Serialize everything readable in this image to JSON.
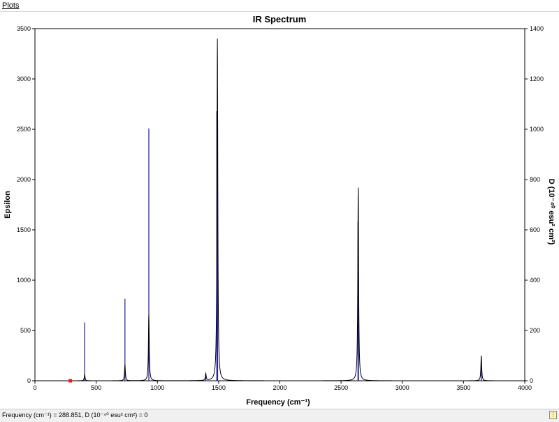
{
  "menu": {
    "plots_label": "Plots"
  },
  "status": {
    "text": "Frequency (cm⁻¹) = 288.851, D (10⁻⁴⁰ esu² cm²) = 0",
    "grip_icon": "resize-grip-icon"
  },
  "colors": {
    "spectrum_line": "#000000",
    "stick_bars": "#1a1aa0",
    "cursor_marker": "#dd2222"
  },
  "chart_data": {
    "type": "line",
    "title": "IR Spectrum",
    "xlabel": "Frequency (cm⁻¹)",
    "ylabel_left": "Epsilon",
    "ylabel_right": "D (10⁻⁴⁰ esu² cm²)",
    "xlim": [
      0,
      4000
    ],
    "ylim_left": [
      0,
      3500
    ],
    "ylim_right": [
      0,
      1400
    ],
    "x_ticks": [
      "0",
      "500",
      "1000",
      "1500",
      "2000",
      "2500",
      "3000",
      "3500",
      "4000"
    ],
    "y_left_ticks": [
      "0",
      "500",
      "1000",
      "1500",
      "2000",
      "2500",
      "3000",
      "3500"
    ],
    "y_right_ticks": [
      "0",
      "200",
      "400",
      "600",
      "800",
      "1000",
      "1200",
      "1400"
    ],
    "grid": false,
    "cursor_marker_x": 288.851,
    "series": [
      {
        "kind": "spectrum_epsilon",
        "peaks": [
          {
            "x": 406,
            "y": 60
          },
          {
            "x": 735,
            "y": 160
          },
          {
            "x": 930,
            "y": 650
          },
          {
            "x": 1395,
            "y": 70
          },
          {
            "x": 1490,
            "y": 3400
          },
          {
            "x": 2640,
            "y": 1920
          },
          {
            "x": 3645,
            "y": 250
          }
        ]
      },
      {
        "kind": "stick_D",
        "sticks": [
          {
            "x": 406,
            "y": 232
          },
          {
            "x": 735,
            "y": 326
          },
          {
            "x": 930,
            "y": 1003
          },
          {
            "x": 1395,
            "y": 20
          },
          {
            "x": 1485,
            "y": 1072
          },
          {
            "x": 1492,
            "y": 1040
          },
          {
            "x": 2638,
            "y": 634
          },
          {
            "x": 2642,
            "y": 430
          },
          {
            "x": 3645,
            "y": 70
          }
        ]
      }
    ]
  }
}
